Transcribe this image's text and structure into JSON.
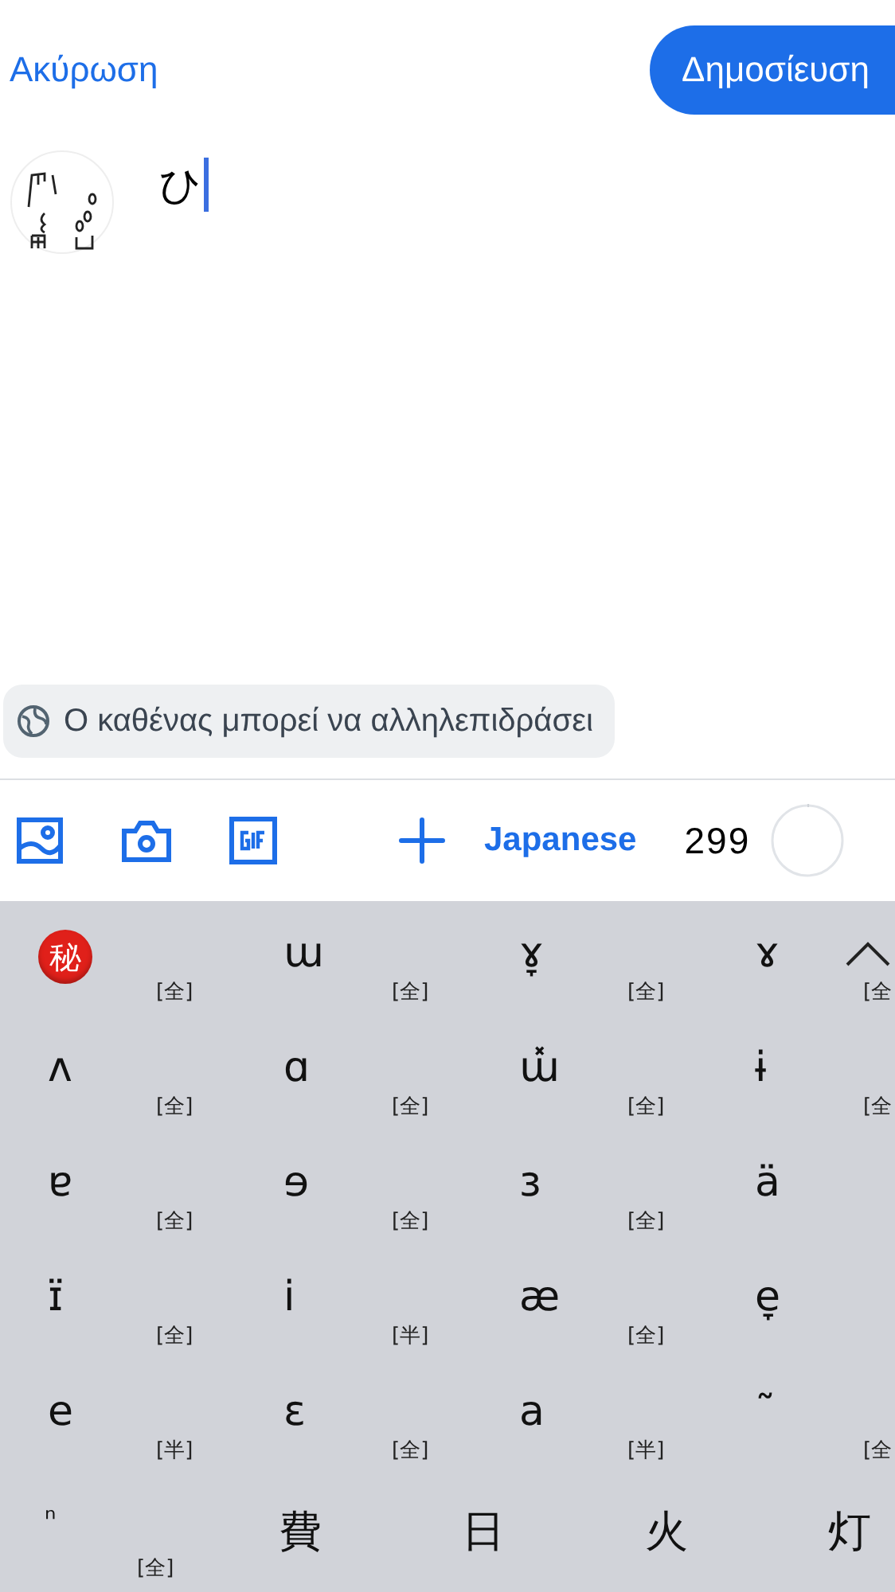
{
  "header": {
    "cancel": "Ακύρωση",
    "publish": "Δημοσίευση"
  },
  "compose": {
    "value": "ひ"
  },
  "reply_setting": {
    "label": "Ο καθένας μπορεί να αλληλεπιδράσει"
  },
  "toolbar": {
    "language": "Japanese",
    "remaining": "299",
    "level": 0.004
  },
  "keyboard": {
    "rows": [
      {
        "kind": "ipa",
        "cells": [
          {
            "text": "秘",
            "kind": "emoji",
            "note": "[全]"
          },
          {
            "text": "ɯ",
            "note": "[全]"
          },
          {
            "text": "ɤ̞",
            "note": "[全]"
          },
          {
            "text": "ɤ",
            "note": "[全"
          }
        ]
      },
      {
        "kind": "ipa",
        "cells": [
          {
            "text": "ʌ",
            "note": "[全]"
          },
          {
            "text": "ɑ",
            "note": "[全]"
          },
          {
            "text": "ɯ̽",
            "note": "[全]"
          },
          {
            "text": "ɨ",
            "note": "[全"
          }
        ]
      },
      {
        "kind": "ipa",
        "cells": [
          {
            "text": "ɐ",
            "note": "[全]"
          },
          {
            "text": "ɘ",
            "note": "[全]"
          },
          {
            "text": "ɜ",
            "note": "[全]"
          },
          {
            "text": "ä"
          }
        ]
      },
      {
        "kind": "ipa",
        "cells": [
          {
            "text": "ɪ̈",
            "note": "[全]"
          },
          {
            "text": "i",
            "note": "[半]"
          },
          {
            "text": "æ",
            "note": "[全]"
          },
          {
            "text": "e̞"
          }
        ]
      },
      {
        "kind": "ipa",
        "cells": [
          {
            "text": "e",
            "note": "[半]"
          },
          {
            "text": "ɛ",
            "note": "[全]"
          },
          {
            "text": "a",
            "note": "[半]"
          },
          {
            "text": "˜",
            "note": "[全"
          }
        ]
      },
      {
        "kind": "kanji",
        "cells": [
          {
            "text": "ⁿ",
            "note": "[全]"
          },
          {
            "text": "費"
          },
          {
            "text": "日"
          },
          {
            "text": "火"
          },
          {
            "text": "灯"
          }
        ]
      }
    ]
  }
}
